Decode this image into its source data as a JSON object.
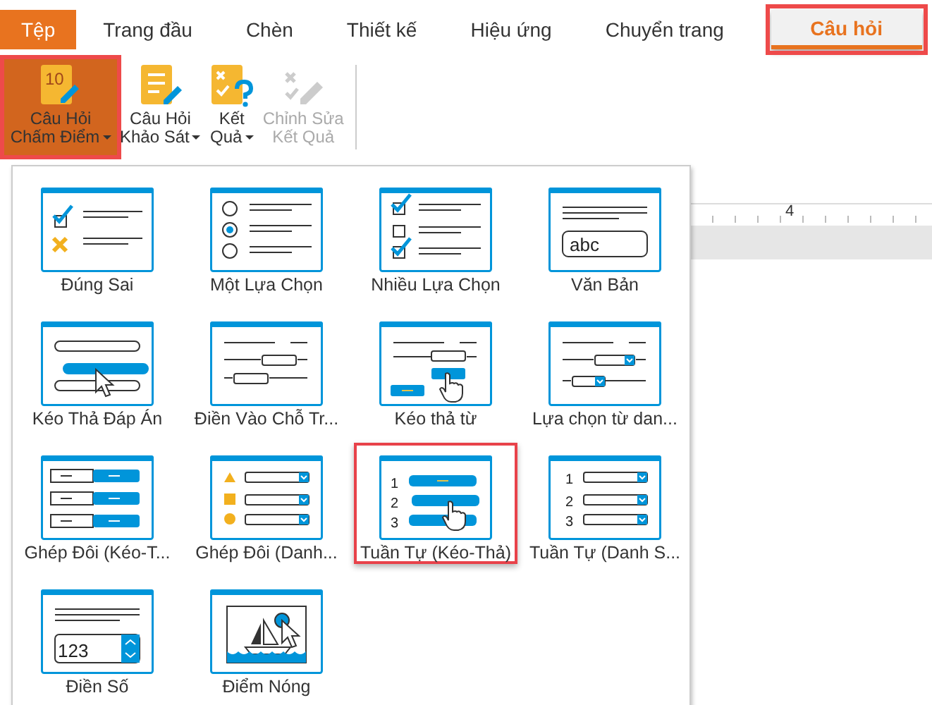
{
  "tabs": [
    {
      "label": "Tệp",
      "kind": "file",
      "selected": false
    },
    {
      "label": "Trang đầu",
      "kind": "tab",
      "selected": false
    },
    {
      "label": "Chèn",
      "kind": "tab",
      "selected": false
    },
    {
      "label": "Thiết kế",
      "kind": "tab",
      "selected": false
    },
    {
      "label": "Hiệu ứng",
      "kind": "tab",
      "selected": false
    },
    {
      "label": "Chuyển trang",
      "kind": "tab",
      "selected": false
    },
    {
      "label": "Câu hỏi",
      "kind": "tab",
      "selected": true
    }
  ],
  "ribbon": [
    {
      "label": "Câu Hỏi Chấm Điểm",
      "kind": "graded",
      "icon_text": "10",
      "dropdown": true,
      "selected": true,
      "disabled": false
    },
    {
      "label": "Câu Hỏi Khảo Sát",
      "kind": "survey",
      "dropdown": true,
      "selected": false,
      "disabled": false
    },
    {
      "label": "Kết Quả",
      "kind": "result",
      "dropdown": true,
      "selected": false,
      "disabled": false
    },
    {
      "label": "Chỉnh Sửa Kết Quả",
      "kind": "edit",
      "dropdown": false,
      "selected": false,
      "disabled": true
    }
  ],
  "ruler": {
    "label": "4"
  },
  "gallery": [
    {
      "label": "Đúng Sai",
      "kind": "true_false",
      "selected": false
    },
    {
      "label": "Một Lựa Chọn",
      "kind": "single_choice",
      "selected": false
    },
    {
      "label": "Nhiều Lựa Chọn",
      "kind": "multi_choice",
      "selected": false
    },
    {
      "label": "Văn Bản",
      "kind": "text",
      "glyphs": [
        "abc"
      ],
      "selected": false
    },
    {
      "label": "Kéo Thả Đáp Án",
      "kind": "drag_answer",
      "selected": false
    },
    {
      "label": "Điền Vào Chỗ Tr...",
      "kind": "fill_blank",
      "selected": false
    },
    {
      "label": "Kéo thả từ",
      "kind": "drag_word",
      "selected": false
    },
    {
      "label": "Lựa chọn từ dan...",
      "kind": "dropdown_choice",
      "selected": false
    },
    {
      "label": "Ghép Đôi (Kéo-T...",
      "kind": "match_drag",
      "selected": false
    },
    {
      "label": "Ghép Đôi (Danh...",
      "kind": "match_list",
      "selected": false
    },
    {
      "label": "Tuần Tự (Kéo-Thả)",
      "kind": "sequence_drag",
      "glyphs": [
        "1",
        "2",
        "3"
      ],
      "selected": true
    },
    {
      "label": "Tuần Tự (Danh S...",
      "kind": "sequence_list",
      "glyphs": [
        "1",
        "2",
        "3"
      ],
      "selected": false
    },
    {
      "label": "Điền Số",
      "kind": "number",
      "glyphs": [
        "123"
      ],
      "selected": false
    },
    {
      "label": "Điểm Nóng",
      "kind": "hotspot",
      "selected": false
    }
  ]
}
